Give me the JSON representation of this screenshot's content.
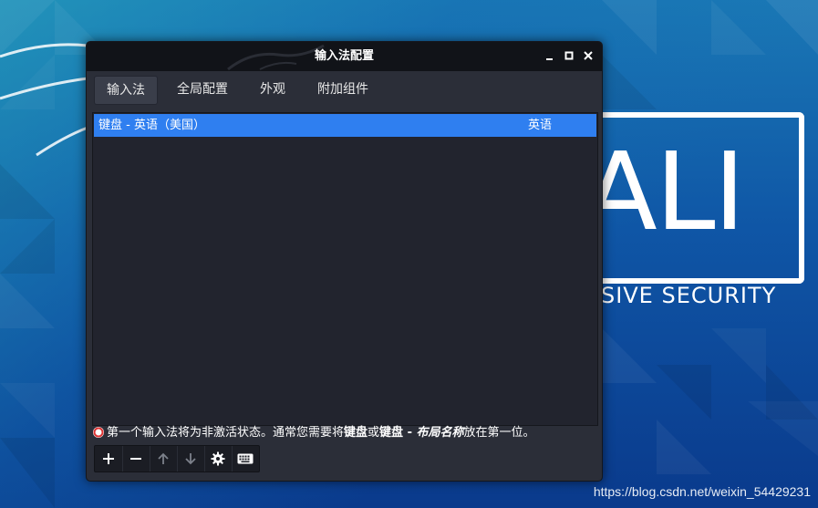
{
  "window": {
    "title": "输入法配置"
  },
  "tabs": [
    {
      "label": "输入法",
      "active": true
    },
    {
      "label": "全局配置",
      "active": false
    },
    {
      "label": "外观",
      "active": false
    },
    {
      "label": "附加组件",
      "active": false
    }
  ],
  "input_methods": [
    {
      "name": "键盘 - 英语（美国）",
      "language": "英语",
      "selected": true
    }
  ],
  "notice": {
    "part1": "第一个输入法将为非激活状态。通常您需要将",
    "bold1": "键盘",
    "part2": "或",
    "bold2": "键盘 - ",
    "bold_italic": "布局名称",
    "part3": "放在第一位。"
  },
  "toolbar": {
    "buttons": [
      "add-icon",
      "remove-icon",
      "arrow-up-icon",
      "arrow-down-icon",
      "gear-icon",
      "keyboard-icon"
    ]
  },
  "desktop": {
    "logo_text": "ALI",
    "tagline": "NSIVE SECURITY",
    "watermark": "https://blog.csdn.net/weixin_54429231"
  },
  "colors": {
    "selection": "#2f7ff0",
    "window_bg": "#2b2e38",
    "titlebar_bg": "#111318"
  }
}
